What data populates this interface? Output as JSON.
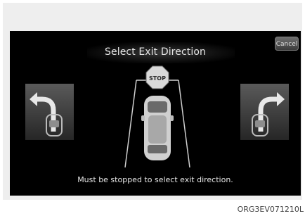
{
  "screen": {
    "title": "Select Exit Direction",
    "cancel_label": "Cancel",
    "stop_sign_label": "STOP",
    "message": "Must be stopped to select exit direction."
  },
  "caption": "ORG3EV071210L",
  "colors": {
    "screen_background": "#000000",
    "text": "#e6e6e6",
    "stop_sign": "#d9d9d9"
  },
  "icons": {
    "left_exit": "left-exit-arrow-icon",
    "right_exit": "right-exit-arrow-icon",
    "stop": "stop-sign-icon",
    "car": "car-icon"
  }
}
